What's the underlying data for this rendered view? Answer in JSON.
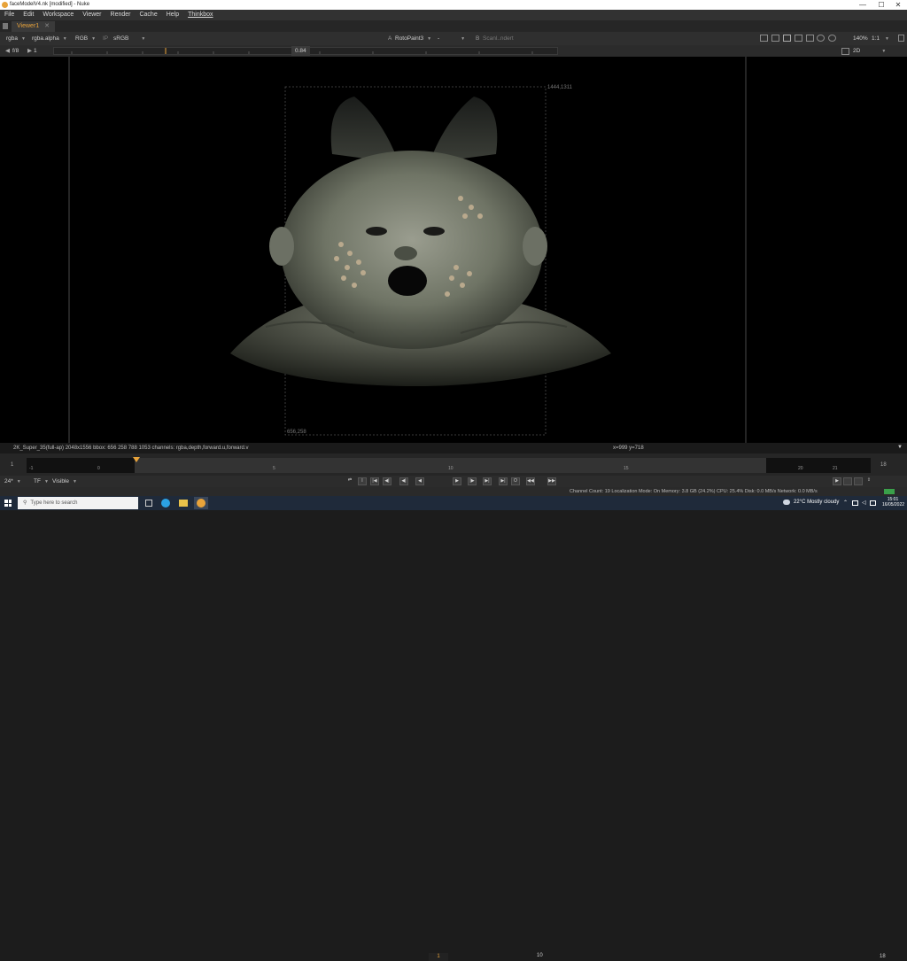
{
  "window": {
    "title": "faceModelV4.nk [modified] - Nuke",
    "controls": [
      "—",
      "☐",
      "✕"
    ]
  },
  "menu": [
    "File",
    "Edit",
    "Workspace",
    "Viewer",
    "Render",
    "Cache",
    "Help",
    "Thinkbox"
  ],
  "tabs": [
    {
      "label": "Viewer1",
      "close": "✕"
    }
  ],
  "viewer_toolbar": {
    "channels": "rgba",
    "alpha": "rgba.alpha",
    "display": "RGB",
    "ip": "IP",
    "colorspace": "sRGB",
    "input_a_label": "A",
    "input_a": "RotoPaint3",
    "compare_mode": "-",
    "input_b_label": "B",
    "input_b": "Scanl..ndert",
    "zoom": "140%",
    "ratio": "1:1",
    "view_mode": "2D"
  },
  "exposure_bar": {
    "fstop": "f/8",
    "frame_step": "1",
    "gain": "0.84"
  },
  "viewer": {
    "bbox_top_right": "1444,1311",
    "bbox_bottom_left": "656,258"
  },
  "info_bar": {
    "format": "2K_Super_35(full-ap) 2048x1556  bbox: 656 258 788 1053 channels: rgba,depth,forward.u,forward.v",
    "coords": "x=999 y=718"
  },
  "timeline": {
    "start": "1",
    "end": "18",
    "ticks": [
      "-1",
      "0",
      "5",
      "10",
      "15",
      "20",
      "21"
    ],
    "current_frame_fraction": 0.13
  },
  "playback": {
    "fps": "24*",
    "tf": "TF",
    "visible": "Visible",
    "current_frame": "1",
    "increment": "10",
    "end_frame": "18"
  },
  "status": {
    "text": "Channel Count: 19  Localization Mode: On  Memory: 3.8 GB (24.2%)  CPU: 25.4%  Disk: 0.0 MB/s  Network: 0.0 MB/s"
  },
  "taskbar": {
    "search_placeholder": "Type here to search",
    "weather": "22°C  Mostly cloudy",
    "time": "15:01",
    "date": "16/05/2022"
  },
  "colors": {
    "accent": "#e8a33a",
    "viewer_bg": "#000000",
    "ui_dark": "#2f2f2f"
  }
}
